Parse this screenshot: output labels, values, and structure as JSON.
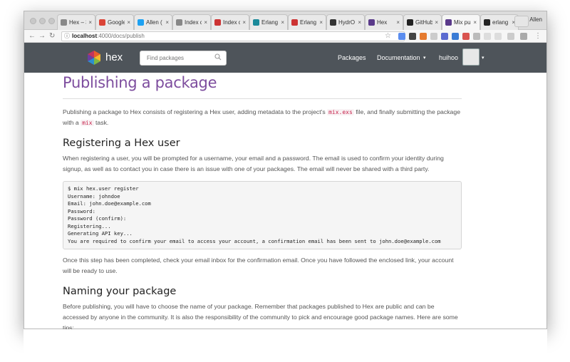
{
  "browser": {
    "tabs": [
      {
        "label": "Hex – 3",
        "icon": "hex-doc-icon",
        "color": "#888888",
        "active": false
      },
      {
        "label": "Google",
        "icon": "google-icon",
        "color": "#db4437",
        "active": false
      },
      {
        "label": "Allen (",
        "icon": "twitter-icon",
        "color": "#1da1f2",
        "active": false
      },
      {
        "label": "Index c",
        "icon": "hex-doc-icon",
        "color": "#888888",
        "active": false
      },
      {
        "label": "Index c",
        "icon": "red-doc-icon",
        "color": "#cc3333",
        "active": false
      },
      {
        "label": "Erlang",
        "icon": "erlang-b-icon",
        "color": "#1b8a9a",
        "active": false
      },
      {
        "label": "Erlang",
        "icon": "erlang-icon",
        "color": "#cc3333",
        "active": false
      },
      {
        "label": "HydrO",
        "icon": "book-icon",
        "color": "#333333",
        "active": false
      },
      {
        "label": "Hex",
        "icon": "hex-logo-icon",
        "color": "#5a3a8a",
        "active": false
      },
      {
        "label": "GitHub",
        "icon": "github-icon",
        "color": "#222222",
        "active": false
      },
      {
        "label": "Mix pu",
        "icon": "hex-logo-icon",
        "color": "#5a3a8a",
        "active": true
      },
      {
        "label": "erlang",
        "icon": "github-icon",
        "color": "#222222",
        "active": false
      }
    ],
    "close_glyph": "×",
    "profile_name": "Allen",
    "url_host": "localhost",
    "url_path": ":4000/docs/publish"
  },
  "site": {
    "brand": "hex",
    "search_placeholder": "Find packages",
    "nav": {
      "packages": "Packages",
      "documentation": "Documentation",
      "user": "huihoo"
    },
    "caret": "▾"
  },
  "page": {
    "title": "Publishing a package",
    "intro_1": "Publishing a package to Hex consists of registering a Hex user, adding metadata to the project's ",
    "intro_code_1": "mix.exs",
    "intro_2": " file, and finally submitting the package with a ",
    "intro_code_2": "mix",
    "intro_3": " task.",
    "section_1_title": "Registering a Hex user",
    "section_1_text": "When registering a user, you will be prompted for a username, your email and a password. The email is used to confirm your identity during signup, as well as to contact you in case there is an issue with one of your packages. The email will never be shared with a third party.",
    "code_block": "$ mix hex.user register\nUsername: johndoe\nEmail: john.doe@example.com\nPassword:\nPassword (confirm):\nRegistering...\nGenerating API key...\nYou are required to confirm your email to access your account, a confirmation email has been sent to john.doe@example.com",
    "section_1_after": "Once this step has been completed, check your email inbox for the confirmation email. Once you have followed the enclosed link, your account will be ready to use.",
    "section_2_title": "Naming your package",
    "section_2_text": "Before publishing, you will have to choose the name of your package. Remember that packages published to Hex are public and can be accessed by anyone in the community. It is also the responsibility of the community to pick and encourage good package names. Here are some tips:"
  }
}
